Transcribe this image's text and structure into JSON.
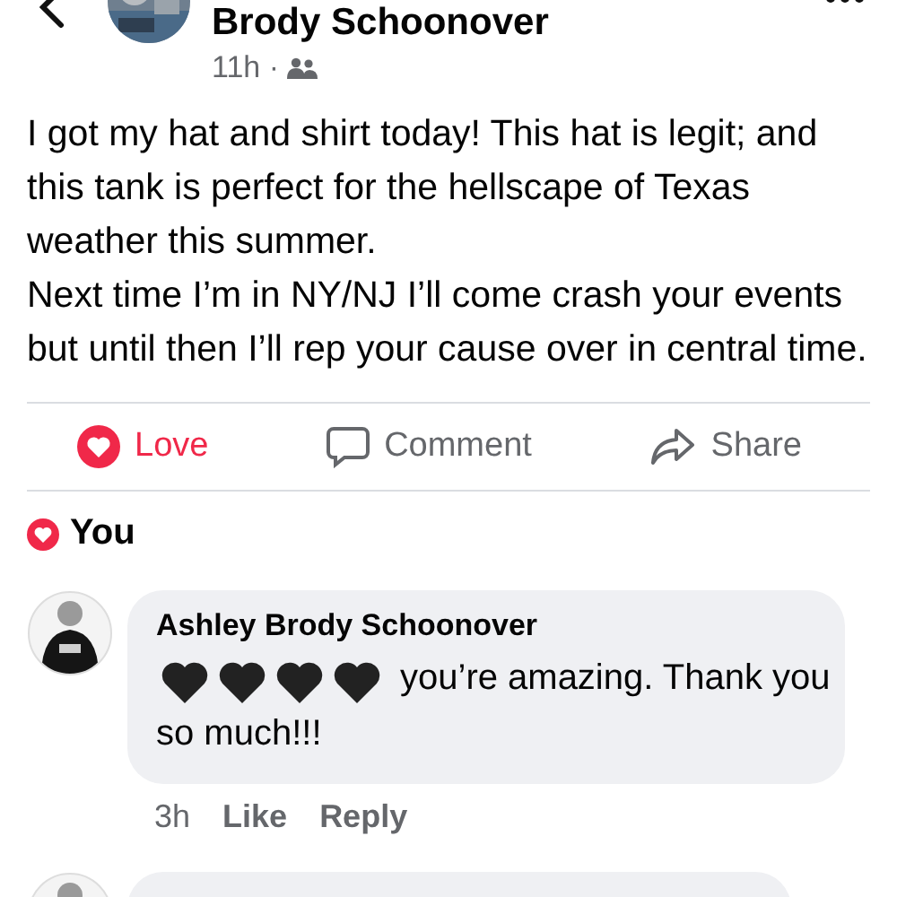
{
  "post": {
    "author": "Brody Schoonover",
    "time": "11h ·",
    "text": "I got my hat and shirt today! This hat is legit; and this tank is perfect for the hellscape of Texas weather this summer.\nNext time I’m in NY/NJ I’ll come crash your events but until then I’ll rep your cause over in central time."
  },
  "actions": [
    {
      "kind": "love",
      "label": "Love",
      "selected": true
    },
    {
      "kind": "comment",
      "label": "Comment",
      "selected": false
    },
    {
      "kind": "share",
      "label": "Share",
      "selected": false
    }
  ],
  "reactions": {
    "label": "You"
  },
  "comments": [
    {
      "author": "Ashley Brody Schoonover",
      "text_lines": [
        "you’re amazing. Thank you",
        "so much!!!"
      ],
      "time": "3h",
      "like": "Like",
      "reply": "Reply"
    }
  ]
}
